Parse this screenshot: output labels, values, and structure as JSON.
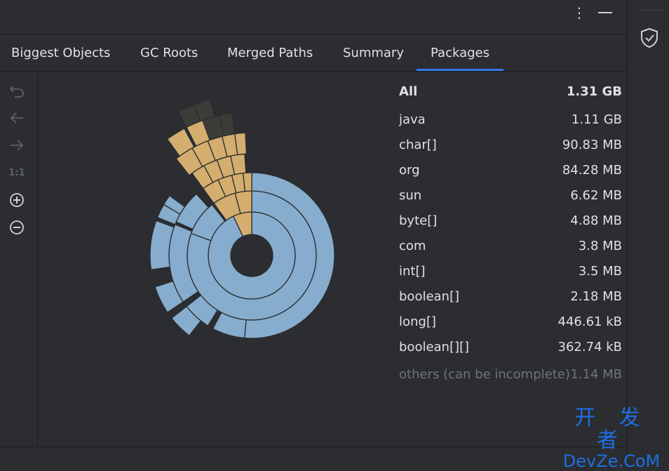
{
  "window": {
    "more_icon": "more-vertical-icon",
    "minimize_icon": "minimize-icon"
  },
  "tabs": [
    {
      "label": "Biggest Objects",
      "active": false
    },
    {
      "label": "GC Roots",
      "active": false
    },
    {
      "label": "Merged Paths",
      "active": false
    },
    {
      "label": "Summary",
      "active": false
    },
    {
      "label": "Packages",
      "active": true
    }
  ],
  "toolbar": {
    "undo_icon": "undo-icon",
    "back_icon": "arrow-left-icon",
    "forward_icon": "arrow-right-icon",
    "reset_zoom_label": "1:1",
    "zoom_in_icon": "zoom-in-icon",
    "zoom_out_icon": "zoom-out-icon"
  },
  "sidebar_right": {
    "icon": "shield-check-icon"
  },
  "packages": {
    "header": {
      "name": "All",
      "size": "1.31 GB"
    },
    "rows": [
      {
        "name": "java",
        "size": "1.11 GB"
      },
      {
        "name": "char[]",
        "size": "90.83 MB"
      },
      {
        "name": "org",
        "size": "84.28 MB"
      },
      {
        "name": "sun",
        "size": "6.62 MB"
      },
      {
        "name": "byte[]",
        "size": "4.88 MB"
      },
      {
        "name": "com",
        "size": "3.8 MB"
      },
      {
        "name": "int[]",
        "size": "3.5 MB"
      },
      {
        "name": "boolean[]",
        "size": "2.18 MB"
      },
      {
        "name": "long[]",
        "size": "446.61 kB"
      },
      {
        "name": "boolean[][]",
        "size": "362.74 kB"
      }
    ],
    "others": {
      "name": "others (can be incomplete)",
      "size": "1.14 MB"
    }
  },
  "colors": {
    "primary_segment": "#86adcd",
    "highlight_segment": "#d4ae6e",
    "dim_segment": "#3e3c38",
    "accent": "#3574f0"
  },
  "watermark": {
    "line1": "开 发 者",
    "line2": "DevZe.CoM"
  }
}
